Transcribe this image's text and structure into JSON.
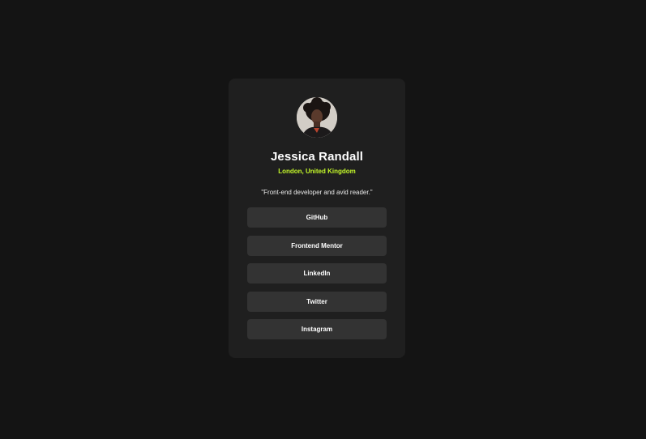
{
  "profile": {
    "avatar_icon": "profile-photo",
    "name": "Jessica Randall",
    "location": "London, United Kingdom",
    "bio": "\"Front-end developer and avid reader.\""
  },
  "links": [
    {
      "label": "GitHub"
    },
    {
      "label": "Frontend Mentor"
    },
    {
      "label": "LinkedIn"
    },
    {
      "label": "Twitter"
    },
    {
      "label": "Instagram"
    }
  ],
  "colors": {
    "background": "#141414",
    "card": "#1f1f1f",
    "button": "#333333",
    "accent": "#c4f82a",
    "text": "#ffffff"
  }
}
